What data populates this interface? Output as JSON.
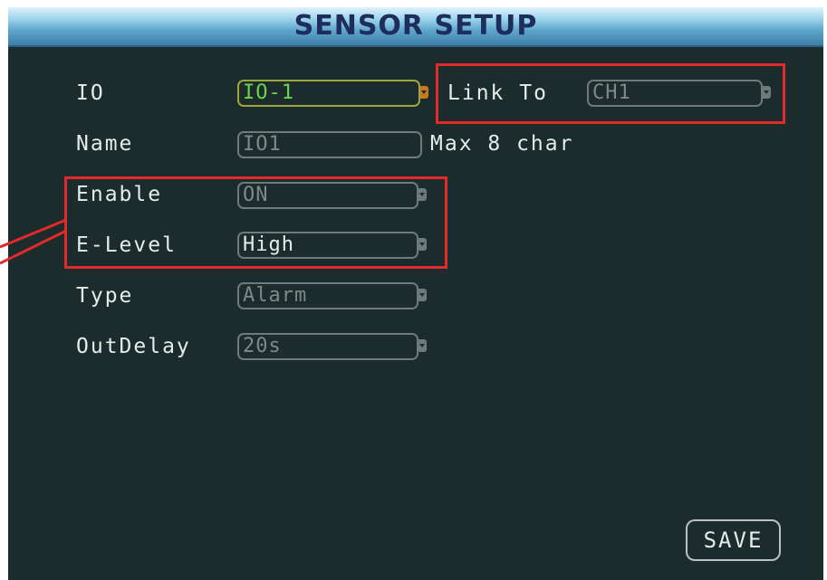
{
  "title": "SENSOR SETUP",
  "rows": [
    {
      "label": "IO",
      "value": "IO-1"
    },
    {
      "label": "Name",
      "value": "IO1"
    },
    {
      "label": "Enable",
      "value": "ON"
    },
    {
      "label": "E-Level",
      "value": "High"
    },
    {
      "label": "Type",
      "value": "Alarm"
    },
    {
      "label": "OutDelay",
      "value": "20s"
    }
  ],
  "link_to": {
    "label": "Link To",
    "value": "CH1"
  },
  "name_hint": "Max 8 char",
  "save_label": "SAVE",
  "colors": {
    "highlight": "#e12a2a",
    "active_text": "#6bd34e",
    "background": "#1c2b2b"
  }
}
